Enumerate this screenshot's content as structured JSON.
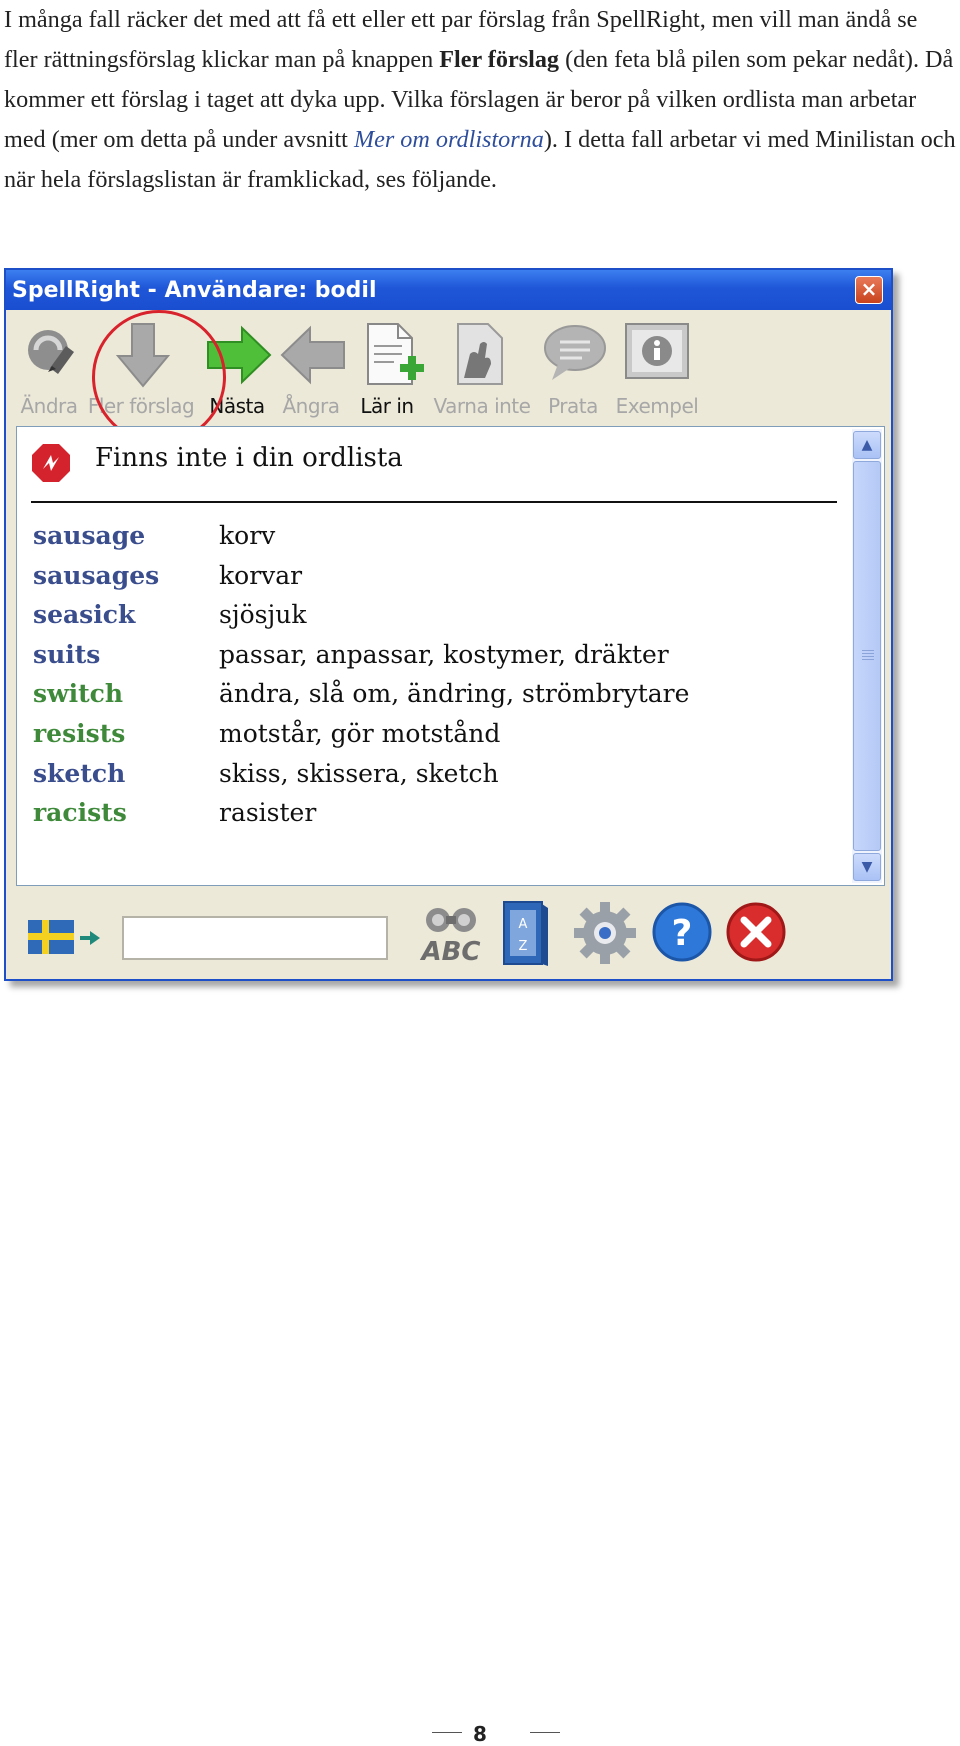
{
  "intro": {
    "p1": "I många fall räcker det med att få ett eller ett par förslag från SpellRight, men vill man ändå se fler rättningsförslag klickar man på knappen ",
    "bold": "Fler förslag",
    "p2": " (den feta blå pilen som pekar nedåt). Då kommer ett förslag i taget att dyka upp. Vilka förslagen är beror på vilken ordlista man arbetar med (mer om detta på under avsnitt ",
    "ref": "Mer om ordlistorna",
    "p3": "). I detta fall arbetar vi med Minilistan och när hela förslagslistan är framklickad, ses följande."
  },
  "window": {
    "title": "SpellRight - Användare: bodil",
    "close": "×",
    "toolbar": [
      {
        "label": "Ändra",
        "icon": "edit-icon",
        "active": false
      },
      {
        "label": "Fler förslag",
        "icon": "arrow-down-icon",
        "active": false
      },
      {
        "label": "Nästa",
        "icon": "arrow-right-icon",
        "active": true
      },
      {
        "label": "Ångra",
        "icon": "arrow-left-icon",
        "active": false
      },
      {
        "label": "Lär in",
        "icon": "document-add-icon",
        "active": true
      },
      {
        "label": "Varna inte",
        "icon": "document-hand-icon",
        "active": false
      },
      {
        "label": "Prata",
        "icon": "speech-bubble-icon",
        "active": false
      },
      {
        "label": "Exempel",
        "icon": "info-icon",
        "active": false
      }
    ],
    "heading": "Finns inte i din ordlista",
    "suggestions": [
      {
        "word": "sausage",
        "translation": "korv",
        "color": "#3a4d8c"
      },
      {
        "word": "sausages",
        "translation": "korvar",
        "color": "#3a4d8c"
      },
      {
        "word": "seasick",
        "translation": "sjösjuk",
        "color": "#3a4d8c"
      },
      {
        "word": "suits",
        "translation": "passar, anpassar, kostymer, dräkter",
        "color": "#3a4d8c"
      },
      {
        "word": "switch",
        "translation": "ändra, slå om, ändring, strömbrytare",
        "color": "#3e8a3a"
      },
      {
        "word": "resists",
        "translation": "motstår, gör motstånd",
        "color": "#3e8a3a"
      },
      {
        "word": "sketch",
        "translation": "skiss, skissera, sketch",
        "color": "#3a4d8c"
      },
      {
        "word": "racists",
        "translation": "rasister",
        "color": "#3e8a3a"
      }
    ],
    "search_value": "",
    "bottom_label": "ABC"
  },
  "page_number": "8"
}
